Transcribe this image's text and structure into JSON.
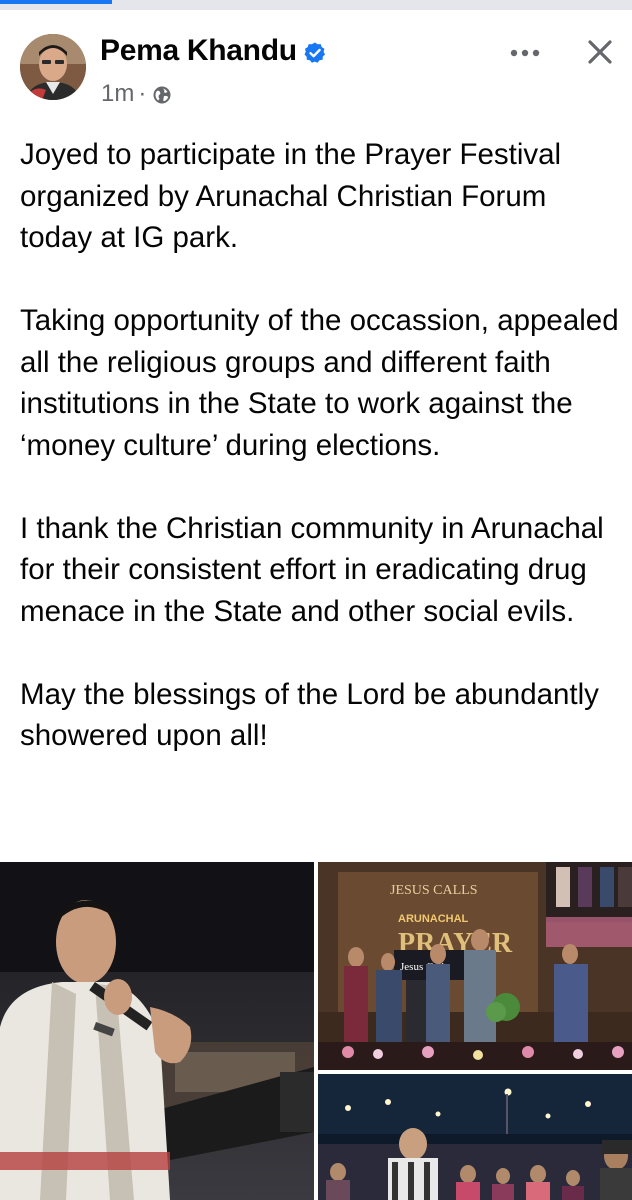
{
  "header": {
    "author_name": "Pema Khandu",
    "time_ago": "1m",
    "separator": "·",
    "verified_icon": "verified-badge-icon",
    "audience_icon": "globe-icon",
    "more_icon": "more-horizontal-icon",
    "close_icon": "close-icon"
  },
  "post": {
    "paragraphs": [
      "Joyed to participate in the Prayer Festival organized by Arunachal Christian Forum today at IG park.",
      "Taking opportunity of the occassion, appealed all the religious groups and different faith institutions in the State to work against the ‘money culture’ during elections.",
      "I thank the Christian community in Arunachal for their consistent effort in eradicating drug menace in the State and other social evils.",
      "May the blessings of the Lord be abundantly showered upon all!"
    ]
  },
  "photos": {
    "banner_brand": "JESUS CALLS",
    "banner_event_top": "ARUNACHAL",
    "banner_event_main": "PRAYER",
    "podium_sign": "Jesus Calls"
  },
  "colors": {
    "brand_blue": "#1877f2",
    "secondary_text": "#65676b",
    "primary_text": "#050505"
  }
}
